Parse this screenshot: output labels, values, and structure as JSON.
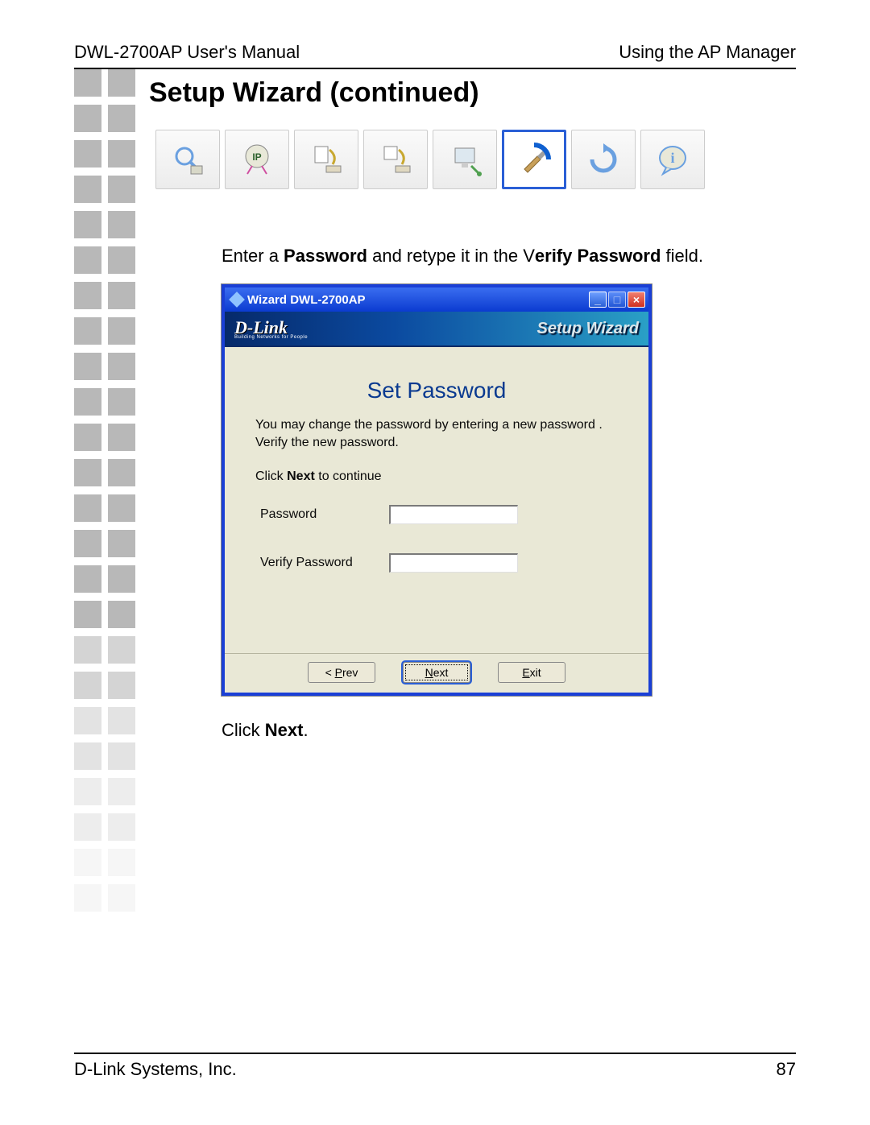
{
  "header": {
    "left": "DWL-2700AP User's Manual",
    "right": "Using the AP Manager"
  },
  "footer": {
    "left": "D-Link Systems, Inc.",
    "page_number": "87"
  },
  "page_title": "Setup Wizard (continued)",
  "toolbar": {
    "items": [
      {
        "name": "discover-icon"
      },
      {
        "name": "ip-settings-icon"
      },
      {
        "name": "device-config-1-icon"
      },
      {
        "name": "device-config-2-icon"
      },
      {
        "name": "firmware-icon"
      },
      {
        "name": "setup-wizard-icon",
        "selected": true
      },
      {
        "name": "refresh-icon"
      },
      {
        "name": "about-icon"
      }
    ]
  },
  "instruction_before": {
    "prefix": "Enter a ",
    "bold1": "Password",
    "mid": " and retype it in the V",
    "bold2": "erify Password",
    "suffix": " field."
  },
  "wizard": {
    "title": "Wizard DWL-2700AP",
    "window_controls": {
      "minimize": "_",
      "maximize": "□",
      "close": "×"
    },
    "brand": "D-Link",
    "brand_sub": "Building Networks for People",
    "banner_title": "Setup Wizard",
    "heading": "Set Password",
    "line1": "You may change the password by entering a new password .",
    "line2": "Verify the new password.",
    "line3_pre": "Click ",
    "line3_bold": "Next",
    "line3_post": " to continue",
    "password_label": "Password",
    "verify_label": "Verify Password",
    "password_value": "",
    "verify_value": "",
    "buttons": {
      "prev": "< Prev",
      "next": "Next",
      "exit": "Exit"
    }
  },
  "instruction_after": {
    "prefix": "Click ",
    "bold": "Next",
    "suffix": "."
  }
}
